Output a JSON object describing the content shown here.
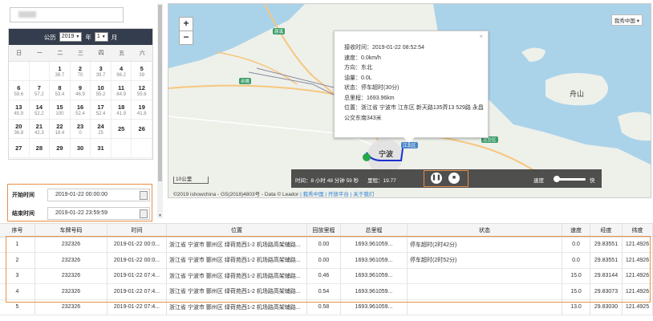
{
  "calendar": {
    "year_label": "公历",
    "year": "2019",
    "year_suffix": "年",
    "month": "1",
    "month_suffix": "月",
    "weekdays": [
      "日",
      "一",
      "二",
      "三",
      "四",
      "五",
      "六"
    ],
    "days": [
      {
        "n": "",
        "v": ""
      },
      {
        "n": "",
        "v": ""
      },
      {
        "n": "1",
        "v": "39.7"
      },
      {
        "n": "2",
        "v": "70"
      },
      {
        "n": "3",
        "v": "39.7"
      },
      {
        "n": "4",
        "v": "96.2"
      },
      {
        "n": "5",
        "v": "39"
      },
      {
        "n": "6",
        "v": "59.6"
      },
      {
        "n": "7",
        "v": "57.2"
      },
      {
        "n": "8",
        "v": "53.4"
      },
      {
        "n": "9",
        "v": "46.9"
      },
      {
        "n": "10",
        "v": "55.2"
      },
      {
        "n": "11",
        "v": "84.9"
      },
      {
        "n": "12",
        "v": "55.6"
      },
      {
        "n": "13",
        "v": "45.9"
      },
      {
        "n": "14",
        "v": "52.2"
      },
      {
        "n": "15",
        "v": "100"
      },
      {
        "n": "16",
        "v": "52.4"
      },
      {
        "n": "17",
        "v": "52.4"
      },
      {
        "n": "18",
        "v": "41.9"
      },
      {
        "n": "19",
        "v": "41.8"
      },
      {
        "n": "20",
        "v": "36.8"
      },
      {
        "n": "21",
        "v": "42.3"
      },
      {
        "n": "22",
        "v": "18.4"
      },
      {
        "n": "23",
        "v": "0"
      },
      {
        "n": "24",
        "v": "25"
      },
      {
        "n": "25",
        "v": ""
      },
      {
        "n": "26",
        "v": ""
      },
      {
        "n": "27",
        "v": ""
      },
      {
        "n": "28",
        "v": ""
      },
      {
        "n": "29",
        "v": ""
      },
      {
        "n": "30",
        "v": ""
      },
      {
        "n": "31",
        "v": ""
      },
      {
        "n": "",
        "v": ""
      },
      {
        "n": "",
        "v": ""
      }
    ]
  },
  "time_range": {
    "start_label": "开始时间",
    "start_value": "2019-01-22 00:00:00",
    "end_label": "结束时间",
    "end_value": "2019-01-22 23:59:59"
  },
  "map": {
    "zoom_in": "+",
    "zoom_out": "−",
    "lang_select": "我秀中国 ▾",
    "scale": "10公里",
    "copyright": "©2019 ishowchina - GS(2018)4803号 - Data © Leador",
    "copyright_links": "| 我秀中国 | 开放平台 | 关于我们",
    "places": [
      "宁波",
      "舟山",
      "慈溪",
      "余姚",
      "江北区",
      "北仑区"
    ],
    "popup": {
      "close": "×",
      "lines": [
        "接收时间：2019-01-22 08:52:54",
        "速度：0.0km/h",
        "方向：东北",
        "油量：0.0L",
        "状态：停车超时(30分)",
        "总里程：1693.96km",
        "位置：浙江省 宁波市 江东区 新天路135弄13 529路 永昌公交东南343米"
      ]
    },
    "playback": {
      "time_text": "时间：8 小时 48 分钟 59 秒",
      "mileage_text": "里程：19.77",
      "pause": "❚❚",
      "stop": "■",
      "speed_label": "速度",
      "fast_label": "快",
      "speed_level": 0.05
    }
  },
  "table": {
    "headers": [
      "序号",
      "车牌号码",
      "时间",
      "位置",
      "回放里程",
      "总里程",
      "状态",
      "速度",
      "经度",
      "纬度"
    ],
    "rows": [
      [
        "1",
        "232326",
        "2019-01-22 00:0...",
        "浙江省 宁波市 鄞州区 绿荷苑西1-2 机场路高架辅路...",
        "0.00",
        "1693.961059...",
        "停车超时(2时42分)",
        "0.0",
        "29.83551",
        "121.4926"
      ],
      [
        "2",
        "232326",
        "2019-01-22 00:0...",
        "浙江省 宁波市 鄞州区 绿荷苑西1-2 机场路高架辅路...",
        "0.00",
        "1693.961059...",
        "停车超时(2时52分)",
        "0.0",
        "29.83551",
        "121.4926"
      ],
      [
        "3",
        "232326",
        "2019-01-22 07:4...",
        "浙江省 宁波市 鄞州区 绿荷苑西1-2 机场路高架辅路...",
        "0.46",
        "1693.961059...",
        "",
        "15.0",
        "29.83144",
        "121.4926"
      ],
      [
        "4",
        "232326",
        "2019-01-22 07:4...",
        "浙江省 宁波市 鄞州区 绿荷苑西1-2 机场路高架辅路...",
        "0.54",
        "1693.961059...",
        "",
        "15.0",
        "29.83073",
        "121.4926"
      ],
      [
        "5",
        "232326",
        "2019-01-22 07:4...",
        "浙江省 宁波市 鄞州区 绿荷苑西1-2 机场路高架辅路...",
        "0.58",
        "1693.961059...",
        "",
        "13.0",
        "29.83030",
        "121.4925"
      ]
    ]
  }
}
